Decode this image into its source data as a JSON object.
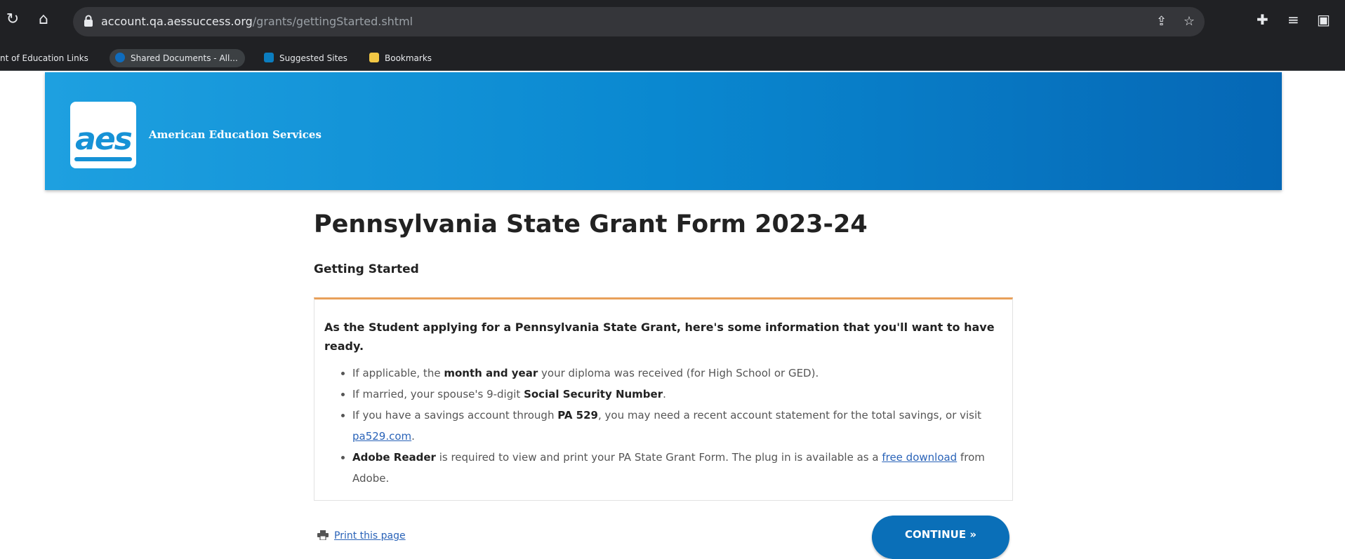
{
  "browser": {
    "url_host": "account.qa.aessuccess.org",
    "url_path": "/grants/gettingStarted.shtml",
    "bookmarks": [
      {
        "label": "nt of Education Links",
        "color": "#4c8bf5"
      },
      {
        "label": "Shared Documents - All...",
        "color": "#0f6cbd"
      },
      {
        "label": "Suggested Sites",
        "color": "#0b7dbf"
      },
      {
        "label": "Bookmarks",
        "color": "#f2c744"
      }
    ]
  },
  "header": {
    "logo_text": "aes",
    "org_name": "American Education Services"
  },
  "main": {
    "title": "Pennsylvania State Grant Form 2023-24",
    "section_heading": "Getting Started",
    "intro": "As the Student applying for a Pennsylvania State Grant, here's some information that you'll want to have ready.",
    "items": [
      {
        "pre": "If applicable, the ",
        "bold": "month and year",
        "post": " your diploma was received (for High School or GED)."
      },
      {
        "pre": "If married, your spouse's 9-digit ",
        "bold": "Social Security Number",
        "post": "."
      },
      {
        "pre": "If you have a savings account through ",
        "bold": "PA 529",
        "mid": ", you may need a recent account statement for the total savings, or visit ",
        "link": "pa529.com",
        "post": "."
      },
      {
        "bold": "Adobe Reader",
        "mid": " is required to view and print your PA State Grant Form. The plug in is available as a ",
        "link": "free download",
        "post": " from Adobe."
      }
    ],
    "print_label": "Print this page",
    "continue_label": "CONTINUE »"
  },
  "colors": {
    "banner_start": "#1ea0e0",
    "banner_end": "#0567b5",
    "accent_border": "#e8a05a",
    "button": "#0a6fb8",
    "link": "#2a63b8"
  }
}
